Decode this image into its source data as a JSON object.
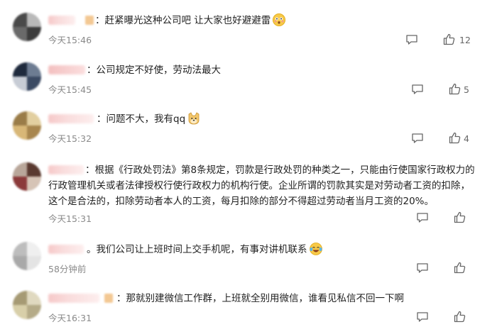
{
  "comments": [
    {
      "text": "：赶紧曝光这种公司吧 让大家也好避避雷",
      "time": "今天15:46",
      "likes": "12",
      "emoji": "flushed-face"
    },
    {
      "text": "：公司规定不好使，劳动法最大",
      "time": "今天15:45",
      "likes": "5"
    },
    {
      "text": "：问题不大，我有qq",
      "time": "今天15:32",
      "likes": "4",
      "emoji": "doge-face"
    },
    {
      "text": "：根据《行政处罚法》第8条规定，罚款是行政处罚的种类之一，只能由行使国家行政权力的行政管理机关或者法律授权行使行政权力的机构行使。企业所谓的罚款其实是对劳动者工资的扣除，这个是合法的，扣除劳动者本人的工资，每月扣除的部分不得超过劳动者当月工资的20%。",
      "time": "今天15:31",
      "likes": ""
    },
    {
      "text": "。我们公司让上班时间上交手机呢，有事对讲机联系",
      "time": "58分钟前",
      "likes": "",
      "emoji": "laughing-tears-face"
    },
    {
      "text": "：那就别建微信工作群，上班就全别用微信，谁看见私信不回一下啊",
      "time": "今天16:31",
      "likes": ""
    }
  ]
}
